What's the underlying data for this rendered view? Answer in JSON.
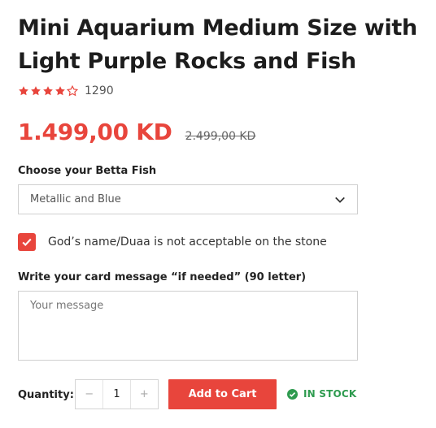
{
  "product": {
    "title": "Mini Aquarium Medium Size with Light Purple Rocks and Fish",
    "rating": {
      "stars": 4,
      "max": 5,
      "count": "1290"
    },
    "price_current": "1.499,00 KD",
    "price_old": "2.499,00 KD"
  },
  "betta": {
    "label": "Choose your Betta Fish",
    "selected": "Metallic and Blue"
  },
  "notice": {
    "checked": true,
    "label": "God’s name/Duaa is not acceptable on the stone"
  },
  "message": {
    "label": "Write your card message “if needed” (90 letter)",
    "placeholder": "Your message"
  },
  "purchase": {
    "quantity_label": "Quantity:",
    "quantity": "1",
    "minus": "−",
    "plus": "+",
    "add_to_cart": "Add to Cart",
    "stock_status": "IN STOCK"
  },
  "colors": {
    "accent": "#e8453c",
    "stock": "#2e9b4f"
  }
}
